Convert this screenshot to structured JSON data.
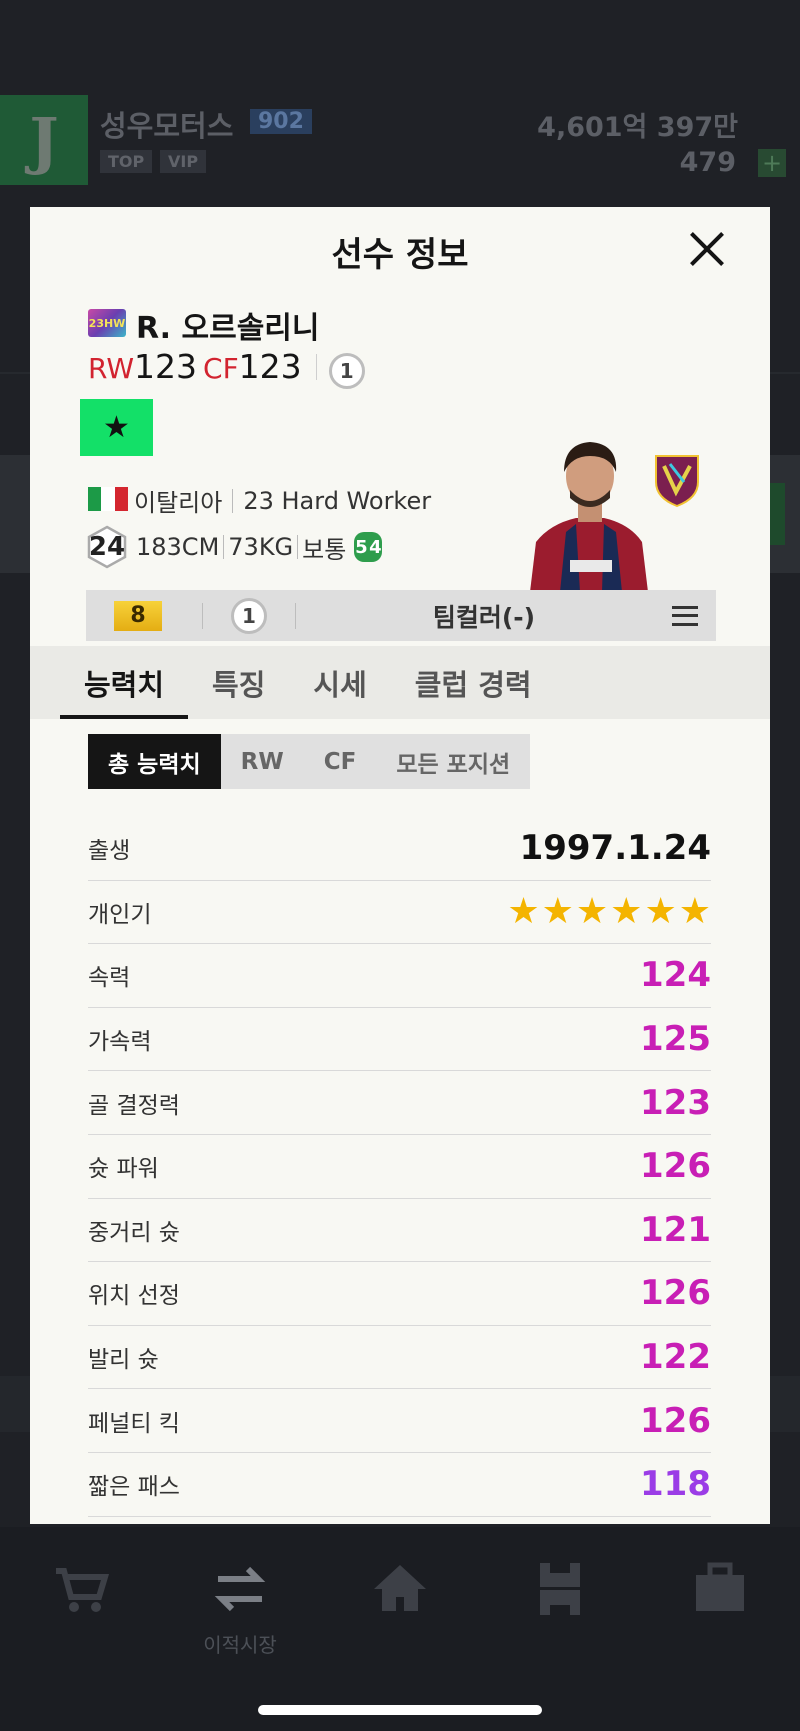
{
  "background": {
    "club_name": "성우모터스",
    "club_level": "902",
    "tags": [
      "TOP",
      "VIP"
    ],
    "money": "4,601억 397만",
    "coins": "479",
    "tab_bar": [
      {
        "label": "",
        "icon": "cart-icon"
      },
      {
        "label": "이적시장",
        "icon": "transfer-icon"
      },
      {
        "label": "",
        "icon": "home-icon"
      },
      {
        "label": "",
        "icon": "field-icon"
      },
      {
        "label": "",
        "icon": "briefcase-icon"
      }
    ]
  },
  "modal": {
    "title": "선수 정보",
    "player": {
      "season_badge": "23HW",
      "name": "R. 오르솔리니",
      "positions": [
        {
          "pos": "RW",
          "ovr": "123"
        },
        {
          "pos": "CF",
          "ovr": "123"
        }
      ],
      "level_circle": "1",
      "nation": "이탈리아",
      "season": "23 Hard Worker",
      "age": "24",
      "height": "183CM",
      "weight": "73KG",
      "body_type": "보통",
      "skill_left": "5",
      "skill_right": "4"
    },
    "enhance": {
      "grade": "8",
      "level": "1",
      "team_color": "팀컬러(-)"
    },
    "tabs": [
      "능력치",
      "특징",
      "시세",
      "클럽 경력"
    ],
    "sub_tabs": [
      "총 능력치",
      "RW",
      "CF",
      "모든 포지션"
    ],
    "stats": [
      {
        "label": "출생",
        "value": "1997.1.24",
        "color": "#111111"
      },
      {
        "label": "개인기",
        "value": "",
        "stars": 6
      },
      {
        "label": "속력",
        "value": "124",
        "color": "#c81fb5"
      },
      {
        "label": "가속력",
        "value": "125",
        "color": "#c81fb5"
      },
      {
        "label": "골 결정력",
        "value": "123",
        "color": "#c81fb5"
      },
      {
        "label": "슛 파워",
        "value": "126",
        "color": "#c81fb5"
      },
      {
        "label": "중거리 슛",
        "value": "121",
        "color": "#c81fb5"
      },
      {
        "label": "위치 선정",
        "value": "126",
        "color": "#c81fb5"
      },
      {
        "label": "발리 슛",
        "value": "122",
        "color": "#c81fb5"
      },
      {
        "label": "페널티 킥",
        "value": "126",
        "color": "#c81fb5"
      },
      {
        "label": "짧은 패스",
        "value": "118",
        "color": "#9b3de6"
      }
    ]
  }
}
